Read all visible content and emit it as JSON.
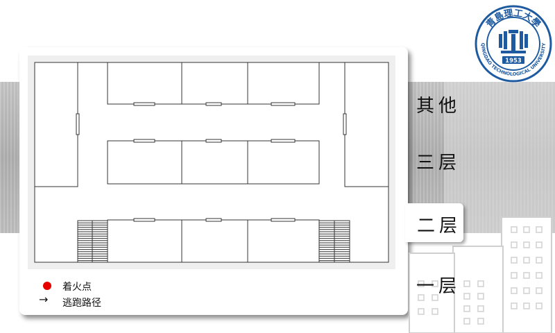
{
  "logo": {
    "name_text": "青島理工大學",
    "english_text": "QINGDAO TECHNOLOGICAL UNIVERSITY",
    "year": "1953"
  },
  "legend": {
    "fire_label": "着火点",
    "route_symbol": "→",
    "route_label": "逃跑路径"
  },
  "floors": {
    "other": "其他",
    "third": "三层",
    "second": "二层",
    "first": "一层",
    "selected": "二层"
  },
  "colors": {
    "fire_point": "#e60000",
    "band": "#bdbdbd",
    "logo_blue": "#1e5aa0"
  }
}
